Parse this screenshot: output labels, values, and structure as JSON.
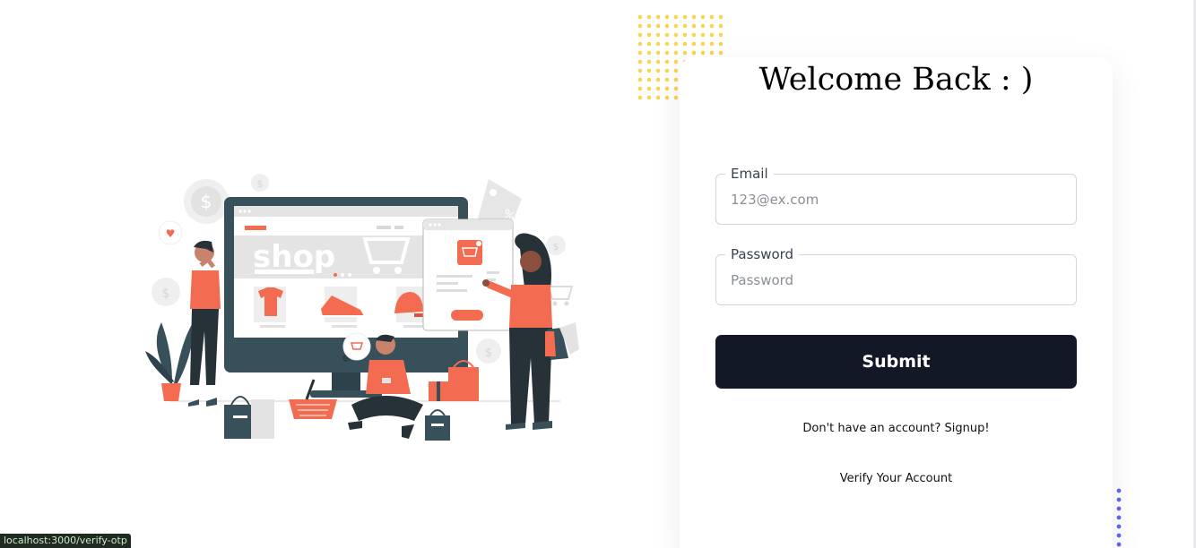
{
  "card": {
    "title": "Welcome Back : )"
  },
  "form": {
    "email": {
      "label": "Email",
      "value": "",
      "placeholder": "123@ex.com"
    },
    "password": {
      "label": "Password",
      "value": "",
      "placeholder": "Password"
    },
    "submit_label": "Submit"
  },
  "links": {
    "signup": "Don't have an account? Signup!",
    "verify": "Verify Your Account"
  },
  "illustration": {
    "screen_text": "shop"
  },
  "status_bar": {
    "url": "localhost:3000/verify-otp"
  },
  "colors": {
    "accent": "#f36b50",
    "dark_teal": "#37505a",
    "button": "#121826",
    "dots_yellow": "#fcd34d",
    "dots_blue": "#6366f1"
  }
}
